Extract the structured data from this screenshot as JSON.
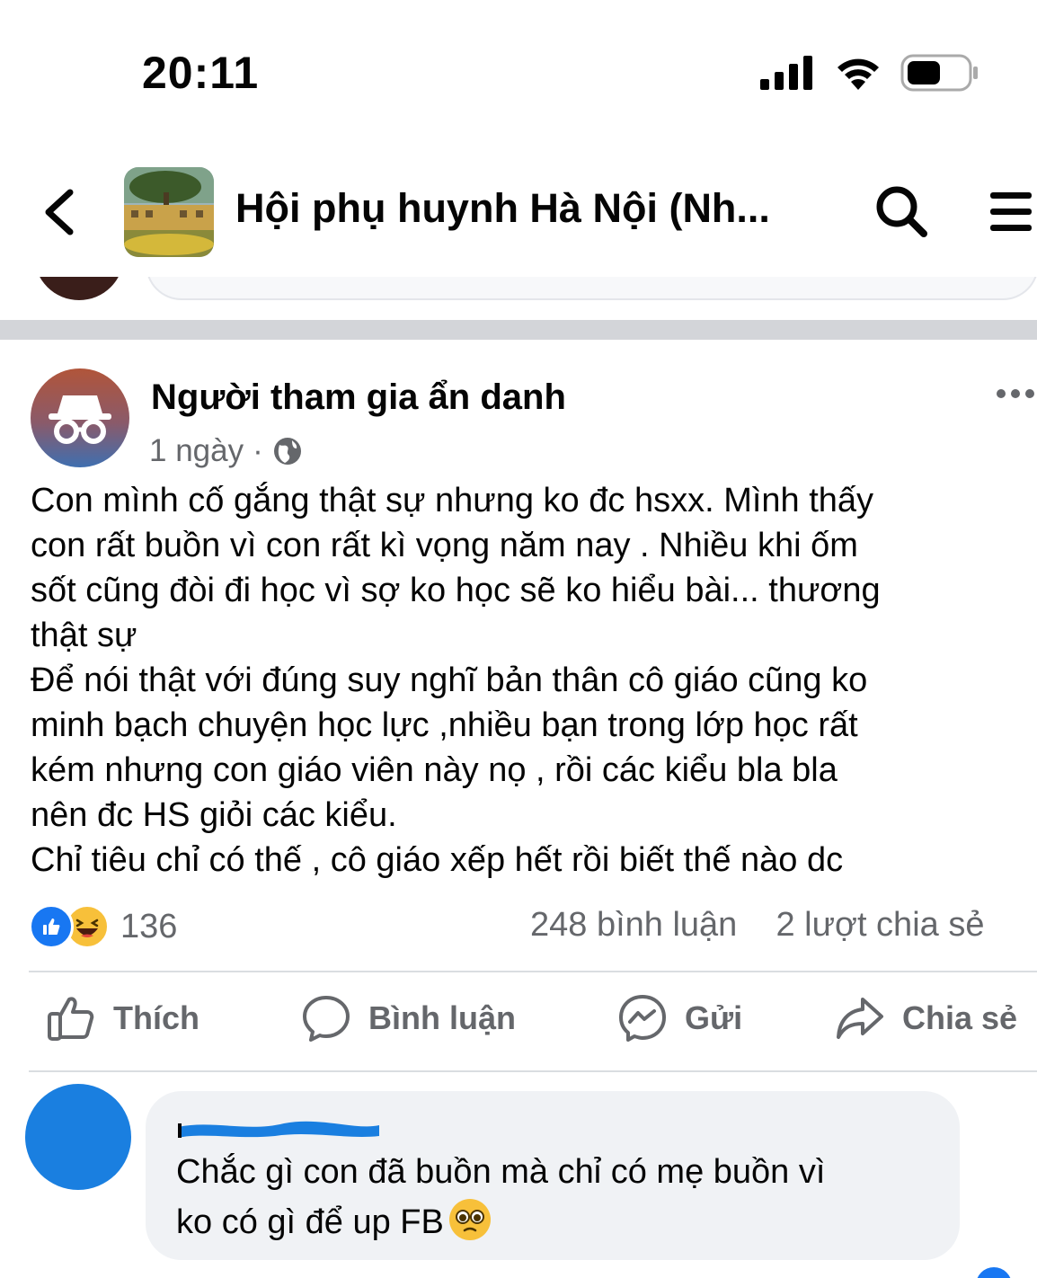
{
  "status_bar": {
    "time": "20:11"
  },
  "header": {
    "group_title": "Hội phụ huynh Hà Nội (Nh...",
    "icons": [
      "back-chevron-icon",
      "search-icon",
      "menu-icon"
    ]
  },
  "post": {
    "author": "Người tham gia ẩn danh",
    "time": "1 ngày",
    "separator": "·",
    "privacy_icon": "globe-icon",
    "body_lines": [
      "Con mình cố gắng thật sự nhưng ko đc hsxx. Mình thấy",
      "con rất buồn vì con rất kì vọng năm nay . Nhiều khi ốm",
      "sốt cũng đòi đi học vì sợ ko học sẽ ko hiểu bài... thương",
      "thật sự",
      "Để nói thật với đúng suy nghĩ bản thân cô giáo cũng ko",
      "minh bạch chuyện học lực ,nhiều bạn trong lớp học rất",
      "kém nhưng con giáo viên này nọ , rồi các kiểu bla bla",
      "nên đc HS giỏi các kiểu.",
      "Chỉ tiêu chỉ có thế , cô giáo xếp hết rồi biết thế nào dc"
    ],
    "reaction_count": "136",
    "comments_count": "248 bình luận",
    "shares_count": "2 lượt chia sẻ"
  },
  "actions": {
    "like": "Thích",
    "comment": "Bình luận",
    "send": "Gửi",
    "share": "Chia sẻ"
  },
  "comment": {
    "text_line1": "Chắc gì con đã buồn mà chỉ có mẹ buồn vì",
    "text_line2": "ko có gì để up FB"
  },
  "colors": {
    "brand_blue": "#1877f2",
    "muted_text": "#65676b",
    "divider": "#dadde1",
    "bubble_bg": "#f0f2f5"
  }
}
